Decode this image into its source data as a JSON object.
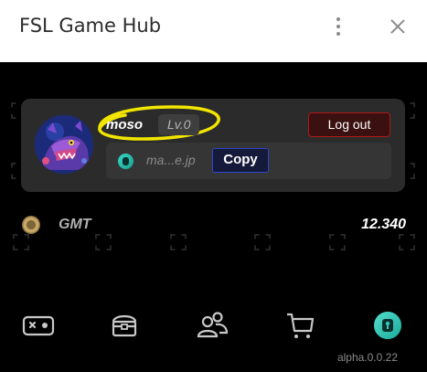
{
  "window": {
    "title": "FSL Game Hub"
  },
  "profile": {
    "username": "moso",
    "level": "Lv.0",
    "logout_label": "Log out",
    "email": "ma...e.jp",
    "copy_label": "Copy"
  },
  "tokens": [
    {
      "symbol": "GMT",
      "amount": "12.340"
    }
  ],
  "nav": [
    {
      "name": "games",
      "icon": "gamepad-icon"
    },
    {
      "name": "store",
      "icon": "treasure-chest-icon"
    },
    {
      "name": "friends",
      "icon": "people-icon"
    },
    {
      "name": "cart",
      "icon": "shopping-cart-icon"
    },
    {
      "name": "wallet",
      "icon": "wallet-keyhole-icon"
    }
  ],
  "version": "alpha.0.0.22",
  "colors": {
    "accent_red": "#b01818",
    "accent_blue": "#2e46c8",
    "wallet_teal": "#2cc9b8",
    "highlight_yellow": "#f2e600"
  }
}
